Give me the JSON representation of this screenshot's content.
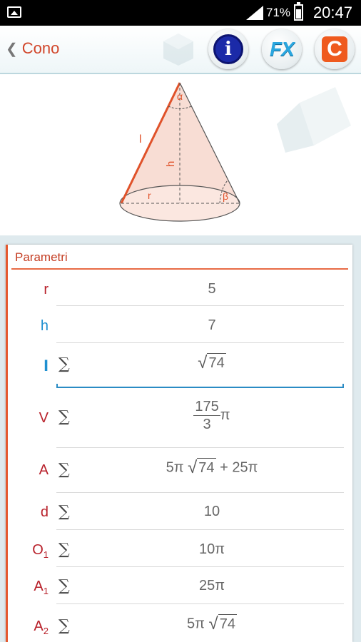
{
  "status": {
    "battery": "71%",
    "time": "20:47"
  },
  "header": {
    "back_chevron": "❮",
    "title": "Cono"
  },
  "toolbar": {
    "info_label": "i",
    "fx_label": "FX",
    "c_label": "C"
  },
  "diagram": {
    "alpha": "α",
    "beta": "β",
    "l": "l",
    "h": "h",
    "r": "r"
  },
  "panel": {
    "title": "Parametri",
    "sigma": "∑",
    "pi": "π",
    "rows": {
      "r": {
        "label": "r",
        "value": "5"
      },
      "h": {
        "label": "h",
        "value": "7"
      },
      "l": {
        "label": "l",
        "radicand": "74"
      },
      "V": {
        "label": "V",
        "num": "175",
        "den": "3"
      },
      "A": {
        "label": "A",
        "pre": "5π",
        "radicand": "74",
        "post": "+ 25π"
      },
      "d": {
        "label": "d",
        "value": "10"
      },
      "O1": {
        "label": "O",
        "sub": "1",
        "value": "10π"
      },
      "A1": {
        "label": "A",
        "sub": "1",
        "value": "25π"
      },
      "A2": {
        "label": "A",
        "sub": "2",
        "pre": "5π",
        "radicand": "74"
      }
    }
  },
  "colors": {
    "accent": "#e55a30",
    "label_red": "#b8202a",
    "label_blue": "#1e8fd0",
    "focus_line": "#2a8bc4"
  }
}
